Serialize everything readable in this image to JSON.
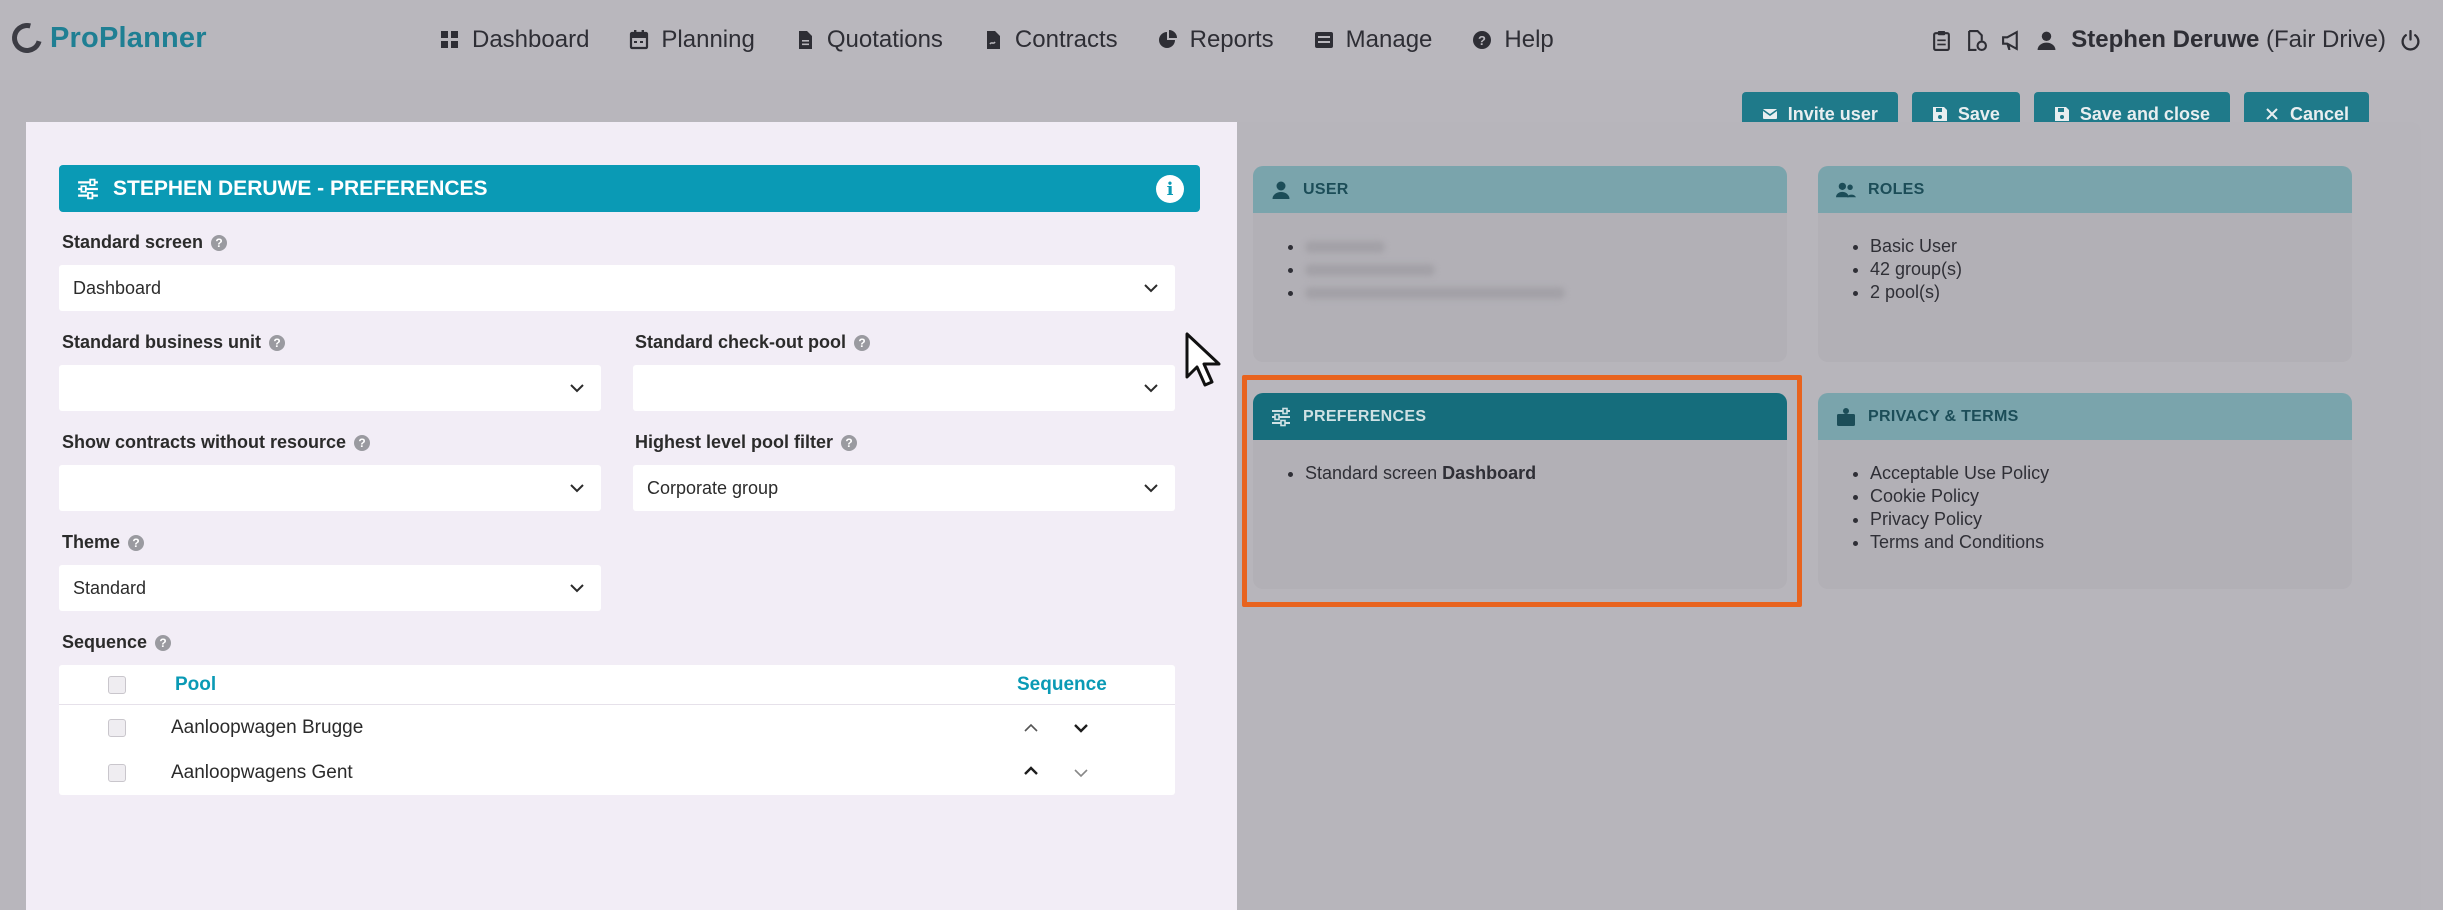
{
  "app": {
    "name": "ProPlanner"
  },
  "nav": {
    "items": [
      {
        "label": "Dashboard",
        "icon": "grid-icon"
      },
      {
        "label": "Planning",
        "icon": "calendar-icon"
      },
      {
        "label": "Quotations",
        "icon": "document-icon"
      },
      {
        "label": "Contracts",
        "icon": "contract-icon"
      },
      {
        "label": "Reports",
        "icon": "pie-chart-icon"
      },
      {
        "label": "Manage",
        "icon": "manage-icon"
      },
      {
        "label": "Help",
        "icon": "help-circle-icon"
      }
    ]
  },
  "user": {
    "name": "Stephen Deruwe",
    "org": "(Fair Drive)"
  },
  "toolbar": {
    "invite_label": "Invite user",
    "save_label": "Save",
    "save_close_label": "Save and close",
    "cancel_label": "Cancel"
  },
  "panel": {
    "title": "STEPHEN DERUWE - PREFERENCES",
    "info_glyph": "i",
    "fields": {
      "standard_screen": {
        "label": "Standard screen",
        "value": "Dashboard"
      },
      "business_unit": {
        "label": "Standard business unit",
        "value": ""
      },
      "checkout_pool": {
        "label": "Standard check-out pool",
        "value": ""
      },
      "contracts_without_resource": {
        "label": "Show contracts without resource",
        "value": ""
      },
      "highest_pool_filter": {
        "label": "Highest level pool filter",
        "value": "Corporate group"
      },
      "theme": {
        "label": "Theme",
        "value": "Standard"
      }
    },
    "sequence": {
      "label": "Sequence",
      "col_pool": "Pool",
      "col_sequence": "Sequence",
      "rows": [
        {
          "pool": "Aanloopwagen Brugge"
        },
        {
          "pool": "Aanloopwagens Gent"
        }
      ]
    }
  },
  "cards": {
    "user": {
      "title": "USER"
    },
    "roles": {
      "title": "ROLES",
      "items": [
        "Basic User",
        "42 group(s)",
        "2 pool(s)"
      ]
    },
    "preferences": {
      "title": "PREFERENCES",
      "item_prefix": "Standard screen",
      "item_value": "Dashboard"
    },
    "privacy": {
      "title": "PRIVACY & TERMS",
      "items": [
        "Acceptable Use Policy",
        "Cookie Policy",
        "Privacy Policy",
        "Terms and Conditions"
      ]
    }
  },
  "colors": {
    "brand": "#1f7f93",
    "panel_header": "#0a9ab5",
    "highlight": "#e8631e"
  }
}
